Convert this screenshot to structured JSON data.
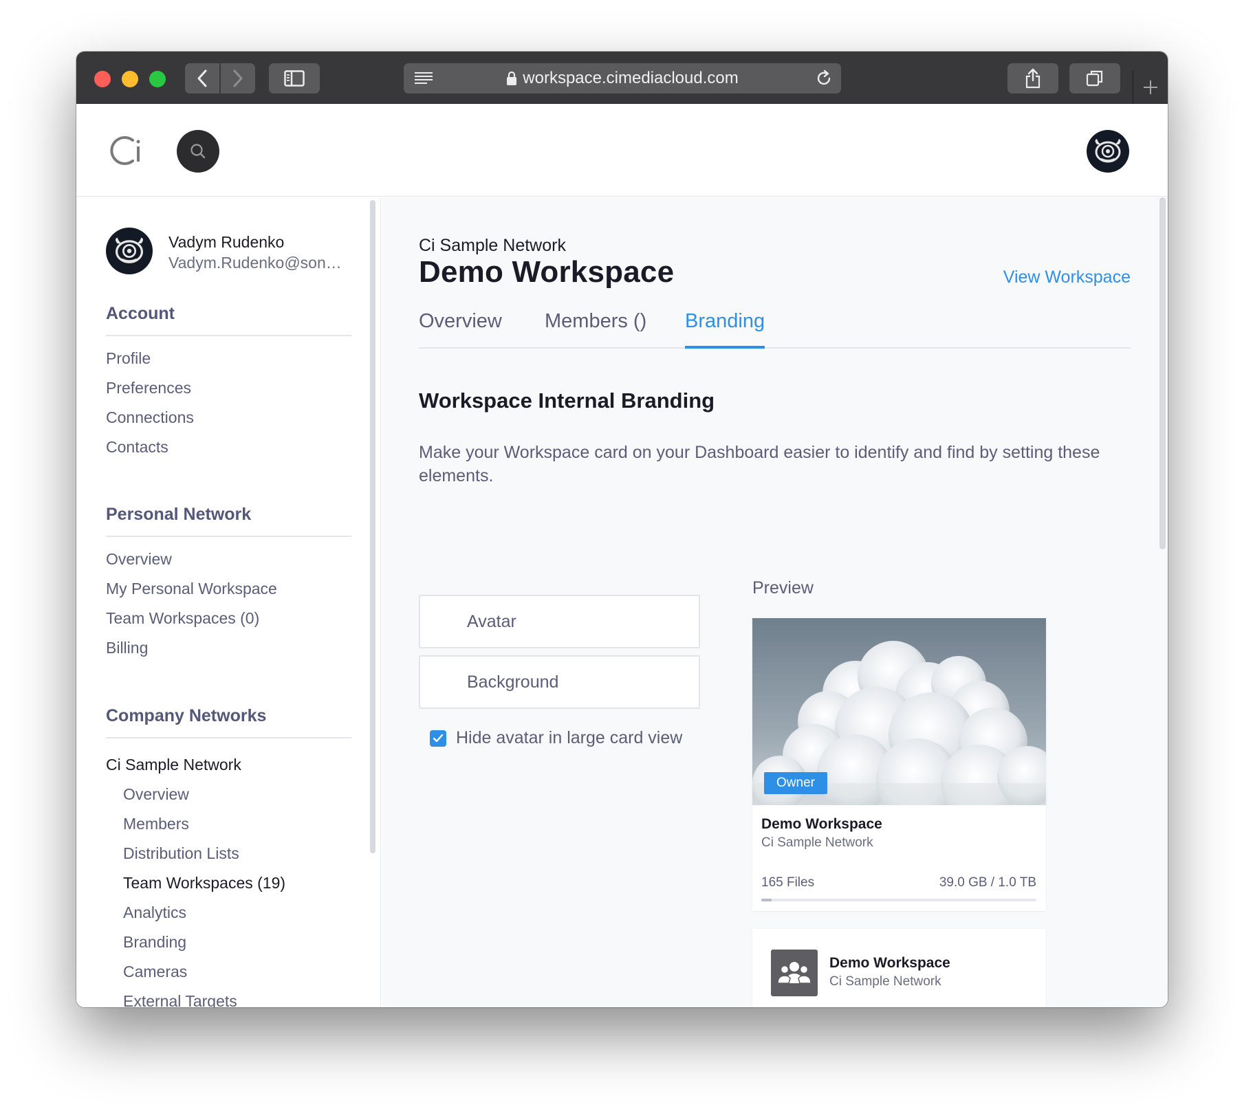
{
  "browser": {
    "url": "workspace.cimediacloud.com"
  },
  "user": {
    "name": "Vadym Rudenko",
    "email": "Vadym.Rudenko@sony...."
  },
  "sidebar": {
    "account": {
      "heading": "Account",
      "items": [
        "Profile",
        "Preferences",
        "Connections",
        "Contacts"
      ]
    },
    "personal_network": {
      "heading": "Personal Network",
      "items": [
        "Overview",
        "My Personal Workspace",
        "Team Workspaces (0)",
        "Billing"
      ]
    },
    "company_networks": {
      "heading": "Company Networks",
      "network_name": "Ci Sample Network",
      "items": [
        "Overview",
        "Members",
        "Distribution Lists",
        "Team Workspaces (19)",
        "Analytics",
        "Branding",
        "Cameras",
        "External Targets"
      ],
      "active_item": "Team Workspaces (19)"
    }
  },
  "workspace": {
    "network": "Ci Sample Network",
    "title": "Demo Workspace",
    "view_link": "View Workspace",
    "tabs": [
      "Overview",
      "Members ()",
      "Branding"
    ],
    "active_tab": "Branding"
  },
  "branding": {
    "title": "Workspace Internal Branding",
    "description": "Make your Workspace card on your Dashboard easier to identify and find by setting these elements.",
    "avatar_button": "Avatar",
    "background_button": "Background",
    "hide_avatar_label": "Hide avatar in large card view",
    "hide_avatar_checked": true,
    "preview_label": "Preview"
  },
  "preview_card": {
    "badge": "Owner",
    "title": "Demo Workspace",
    "subtitle": "Ci Sample Network",
    "files": "165 Files",
    "storage": "39.0 GB / 1.0 TB",
    "storage_fraction": 0.038
  },
  "preview_small": {
    "title": "Demo Workspace",
    "subtitle": "Ci Sample Network",
    "icon": "team-icon"
  },
  "colors": {
    "accent": "#2d8fe5",
    "titlebar": "#38383a",
    "avatar_bg": "#131a26"
  }
}
